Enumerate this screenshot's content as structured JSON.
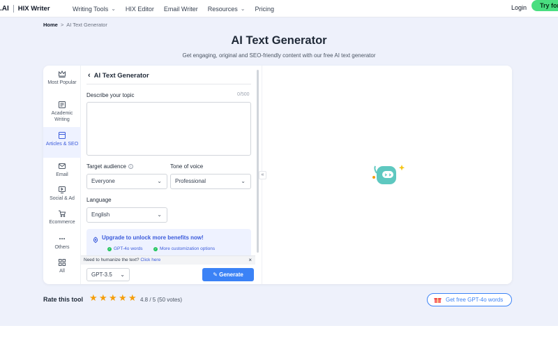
{
  "nav": {
    "brand": ".AI",
    "product": "HIX Writer",
    "links": [
      {
        "label": "Writing Tools",
        "dropdown": true
      },
      {
        "label": "HIX Editor",
        "dropdown": false
      },
      {
        "label": "Email Writer",
        "dropdown": false
      },
      {
        "label": "Resources",
        "dropdown": true
      },
      {
        "label": "Pricing",
        "dropdown": false
      }
    ],
    "login": "Login",
    "try_label": "Try for"
  },
  "breadcrumb": {
    "home": "Home",
    "separator": ">",
    "current": "AI Text Generator"
  },
  "hero": {
    "title": "AI Text Generator",
    "subtitle": "Get engaging, original and SEO-friendly content with our free AI text generator"
  },
  "sidebar": {
    "items": [
      {
        "label": "Most Popular",
        "icon": "crown-icon",
        "active": false
      },
      {
        "label": "Academic Writing",
        "icon": "academic-icon",
        "active": false
      },
      {
        "label": "Articles & SEO",
        "icon": "article-icon",
        "active": true
      },
      {
        "label": "Email",
        "icon": "mail-icon",
        "active": false
      },
      {
        "label": "Social & Ad",
        "icon": "monitor-icon",
        "active": false
      },
      {
        "label": "Ecommerce",
        "icon": "cart-icon",
        "active": false
      },
      {
        "label": "Others",
        "icon": "more-icon",
        "active": false
      },
      {
        "label": "All",
        "icon": "grid-icon",
        "active": false
      }
    ]
  },
  "form": {
    "back_title": "AI Text Generator",
    "topic_label": "Describe your topic",
    "topic_count": "0/500",
    "topic_value": "",
    "audience_label": "Target audience",
    "audience_value": "Everyone",
    "tone_label": "Tone of voice",
    "tone_value": "Professional",
    "language_label": "Language",
    "language_value": "English"
  },
  "upgrade": {
    "title": "Upgrade to unlock more benefits now!",
    "features": [
      "GPT-4o words",
      "More customization options"
    ]
  },
  "humanize": {
    "text": "Need to humanize the text?",
    "link": "Click here"
  },
  "footer_bar": {
    "model": "GPT-3.5",
    "generate": "Generate"
  },
  "rating": {
    "label": "Rate this tool",
    "stars": 5,
    "score_text": "4.8 / 5 (50 votes)"
  },
  "promo": {
    "label": "Get free GPT-4o words"
  },
  "colors": {
    "accent": "#3b82f6",
    "try_bg": "#4ade80",
    "star": "#f59e0b",
    "robot": "#5ec8c0"
  }
}
